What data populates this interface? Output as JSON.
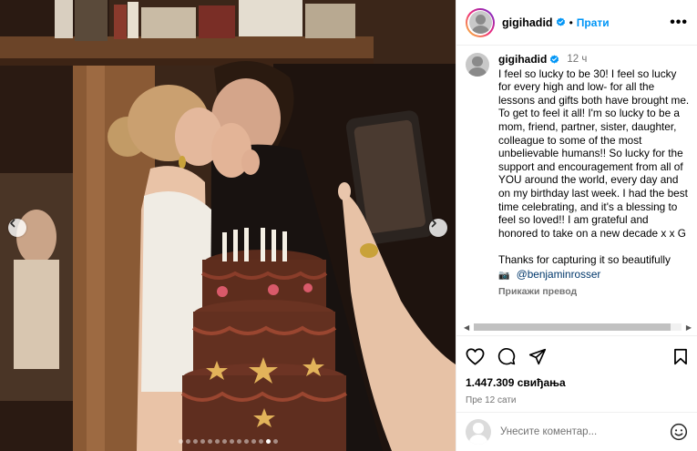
{
  "post": {
    "username": "gigihadid",
    "follow_label": "Прати",
    "dot": "•",
    "more_label": "•••",
    "time_short": "12 ч",
    "caption": "I feel so lucky to be 30! I feel so lucky for every high and low- for all the lessons and gifts both have brought me. To get to feel it all! I'm so lucky to be a mom, friend, partner, sister, daughter, colleague to some of the most unbelievable humans!! So lucky for the support and encouragement from all of YOU around the world, every day and on my birthday last week. I had the best time celebrating, and it's a blessing to feel so loved!! I am grateful and honored to take on a new decade x x G\n\nThanks for capturing it so beautifully",
    "camera_emoji": "📷",
    "mention": "@benjaminrosser",
    "see_translation": "Прикажи превод",
    "likes": "1.447.309 свиђања",
    "posted_ago": "Пре 12 сати"
  },
  "comment": {
    "placeholder": "Унесите коментар..."
  },
  "carousel": {
    "slide_count": 14,
    "active_index": 12
  },
  "icons": {
    "verified": "verified-badge-icon",
    "like": "heart-icon",
    "comment": "comment-bubble-icon",
    "share": "paper-plane-icon",
    "save": "bookmark-icon",
    "emoji": "smiley-icon",
    "prev": "chevron-left-icon",
    "next": "chevron-right-icon"
  },
  "colors": {
    "link_blue": "#0095f6",
    "verified_blue": "#0095f6",
    "mention_blue": "#00376b",
    "muted_gray": "#737373"
  }
}
